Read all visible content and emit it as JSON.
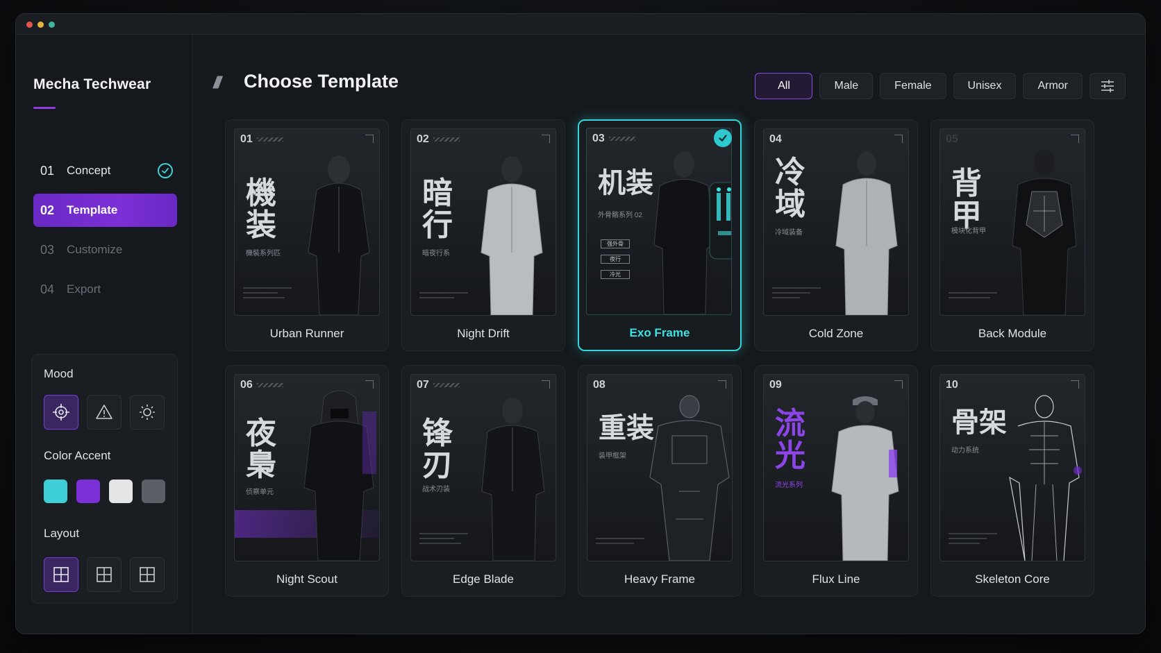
{
  "app": {
    "title": "Mecha Techwear"
  },
  "steps": [
    {
      "num": "01",
      "label": "Concept",
      "state": "done"
    },
    {
      "num": "02",
      "label": "Template",
      "state": "active"
    },
    {
      "num": "03",
      "label": "Customize",
      "state": "pending"
    },
    {
      "num": "04",
      "label": "Export",
      "state": "pending"
    }
  ],
  "panel": {
    "mood_label": "Mood",
    "mood_icons": [
      "crosshair-icon",
      "warning-icon",
      "sun-icon"
    ],
    "mood_selected": 0,
    "color_label": "Color Accent",
    "colors": [
      "#3ecfd6",
      "#7b2fd6",
      "#e4e5e7",
      "#5c6066"
    ],
    "layout_label": "Layout",
    "layout_selected": 0
  },
  "header": {
    "title": "Choose Template"
  },
  "filters": [
    "All",
    "Male",
    "Female",
    "Unisex",
    "Armor"
  ],
  "filter_selected": "All",
  "templates": [
    {
      "num": "01",
      "title": "Urban Runner",
      "cjk": "機装",
      "sub": "機裝系列匹"
    },
    {
      "num": "02",
      "title": "Night Drift",
      "cjk": "暗行",
      "sub": "暗夜行系"
    },
    {
      "num": "03",
      "title": "Exo Frame",
      "cjk": "机装",
      "sub": "外骨骼系列 02",
      "tags": [
        "强外骨",
        "夜行",
        "冷光"
      ],
      "selected": true
    },
    {
      "num": "04",
      "title": "Cold Zone",
      "cjk": "冷域",
      "sub": "冷域装备"
    },
    {
      "num": "05",
      "title": "Back Module",
      "cjk": "背甲",
      "sub": "模块化背甲"
    },
    {
      "num": "06",
      "title": "Night Scout",
      "cjk": "夜梟",
      "sub": "侦察单元"
    },
    {
      "num": "07",
      "title": "Edge Blade",
      "cjk": "锋刃",
      "sub": "战术刃装"
    },
    {
      "num": "08",
      "title": "Heavy Frame",
      "cjk": "重装",
      "sub": "装甲框架"
    },
    {
      "num": "09",
      "title": "Flux Line",
      "cjk": "流光",
      "sub": "流光系列"
    },
    {
      "num": "10",
      "title": "Skeleton Core",
      "cjk": "骨架",
      "sub": "动力系统"
    }
  ]
}
